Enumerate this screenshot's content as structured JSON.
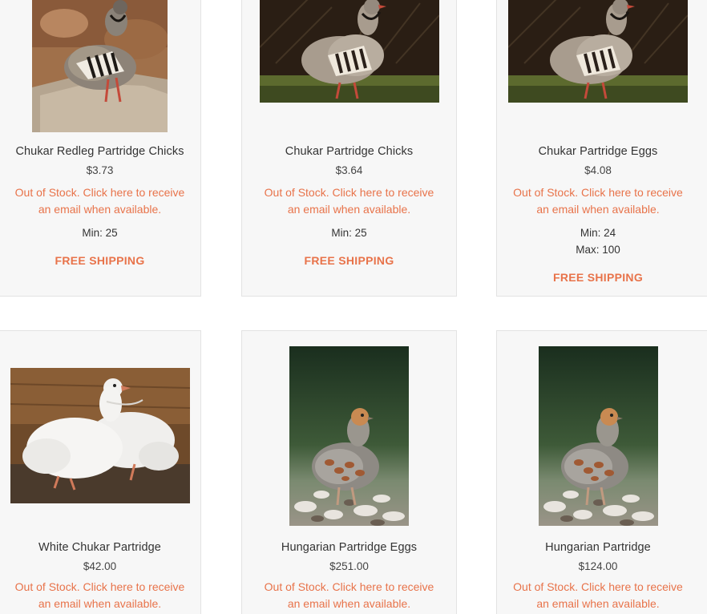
{
  "products": [
    {
      "title": "Chukar Redleg Partridge Chicks",
      "price": "$3.73",
      "stock_line1": "Out of Stock. Click here to receive",
      "stock_line2": "an email when available.",
      "min": "Min:  25",
      "max": "",
      "shipping": "FREE SHIPPING",
      "image": "chukar-partridge-on-rock"
    },
    {
      "title": "Chukar Partridge Chicks",
      "price": "$3.64",
      "stock_line1": "Out of Stock. Click here to receive",
      "stock_line2": "an email when available.",
      "min": "Min:  25",
      "max": "",
      "shipping": "FREE SHIPPING",
      "image": "chukar-partridge-on-grass"
    },
    {
      "title": "Chukar Partridge Eggs",
      "price": "$4.08",
      "stock_line1": "Out of Stock. Click here to receive",
      "stock_line2": "an email when available.",
      "min": "Min:  24",
      "max": "Max: 100",
      "shipping": "FREE SHIPPING",
      "image": "chukar-partridge-on-grass"
    },
    {
      "title": "White Chukar Partridge",
      "price": "$42.00",
      "stock_line1": "Out of Stock. Click here to receive",
      "stock_line2": "an email when available.",
      "image": "white-chukar-pair"
    },
    {
      "title": "Hungarian Partridge Eggs",
      "price": "$251.00",
      "stock_line1": "Out of Stock. Click here to receive",
      "stock_line2": "an email when available.",
      "image": "hungarian-partridge-on-gravel"
    },
    {
      "title": "Hungarian Partridge",
      "price": "$124.00",
      "stock_line1": "Out of Stock. Click here to receive",
      "stock_line2": "an email when available.",
      "image": "hungarian-partridge-on-gravel"
    }
  ],
  "colors": {
    "accent": "#e8734a",
    "card_bg": "#f7f7f7",
    "card_border": "#e3e3e3",
    "text": "#333333"
  }
}
